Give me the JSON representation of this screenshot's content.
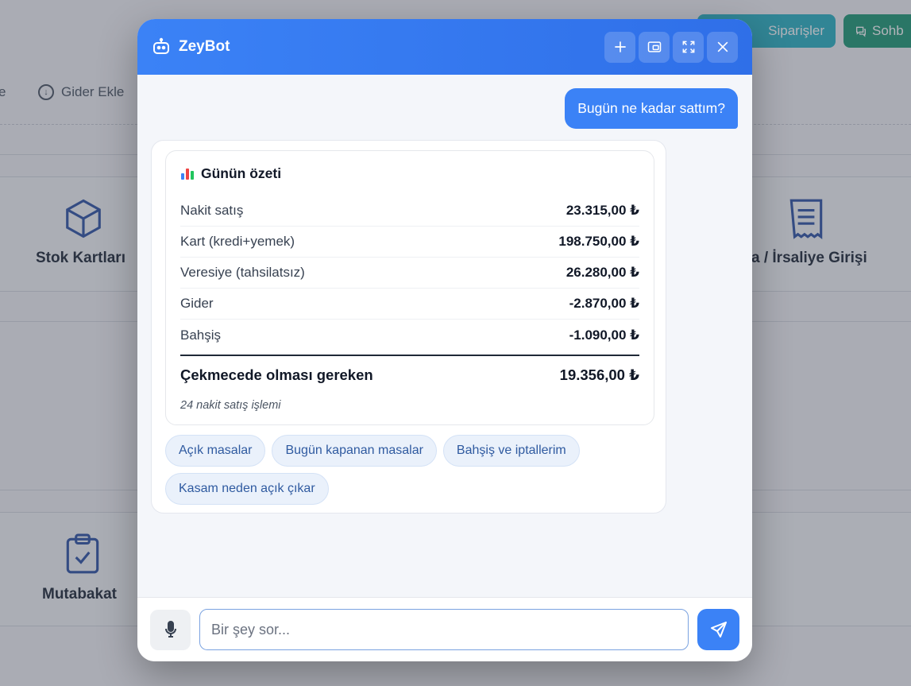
{
  "background": {
    "orders_button": "Siparişler",
    "chat_button": "Sohb",
    "toolbar_fragment": "e",
    "add_expense": "Gider Ekle",
    "tiles": {
      "stock_cards": "Stok Kartları",
      "invoice_entry": "ura / İrsaliye Girişi",
      "reconciliation": "Mutabakat"
    }
  },
  "chat": {
    "title": "ZeyBot",
    "user_message": "Bugün ne kadar sattım?",
    "summary": {
      "title": "Günün özeti",
      "rows": [
        {
          "label": "Nakit satış",
          "value": "23.315,00 ₺"
        },
        {
          "label": "Kart (kredi+yemek)",
          "value": "198.750,00 ₺"
        },
        {
          "label": "Veresiye (tahsilatsız)",
          "value": "26.280,00 ₺"
        },
        {
          "label": "Gider",
          "value": "-2.870,00 ₺"
        },
        {
          "label": "Bahşiş",
          "value": "-1.090,00 ₺"
        }
      ],
      "total_label": "Çekmecede olması gereken",
      "total_value": "19.356,00 ₺",
      "note": "24 nakit satış işlemi"
    },
    "suggestions": [
      "Açık masalar",
      "Bugün kapanan masalar",
      "Bahşiş ve iptallerim",
      "Kasam neden açık çıkar"
    ],
    "input_placeholder": "Bir şey sor..."
  },
  "colors": {
    "accent": "#3b82f6",
    "orders_button": "#2bb3c4",
    "chat_button": "#1e9a76",
    "tile_icon": "#2f54a6"
  }
}
